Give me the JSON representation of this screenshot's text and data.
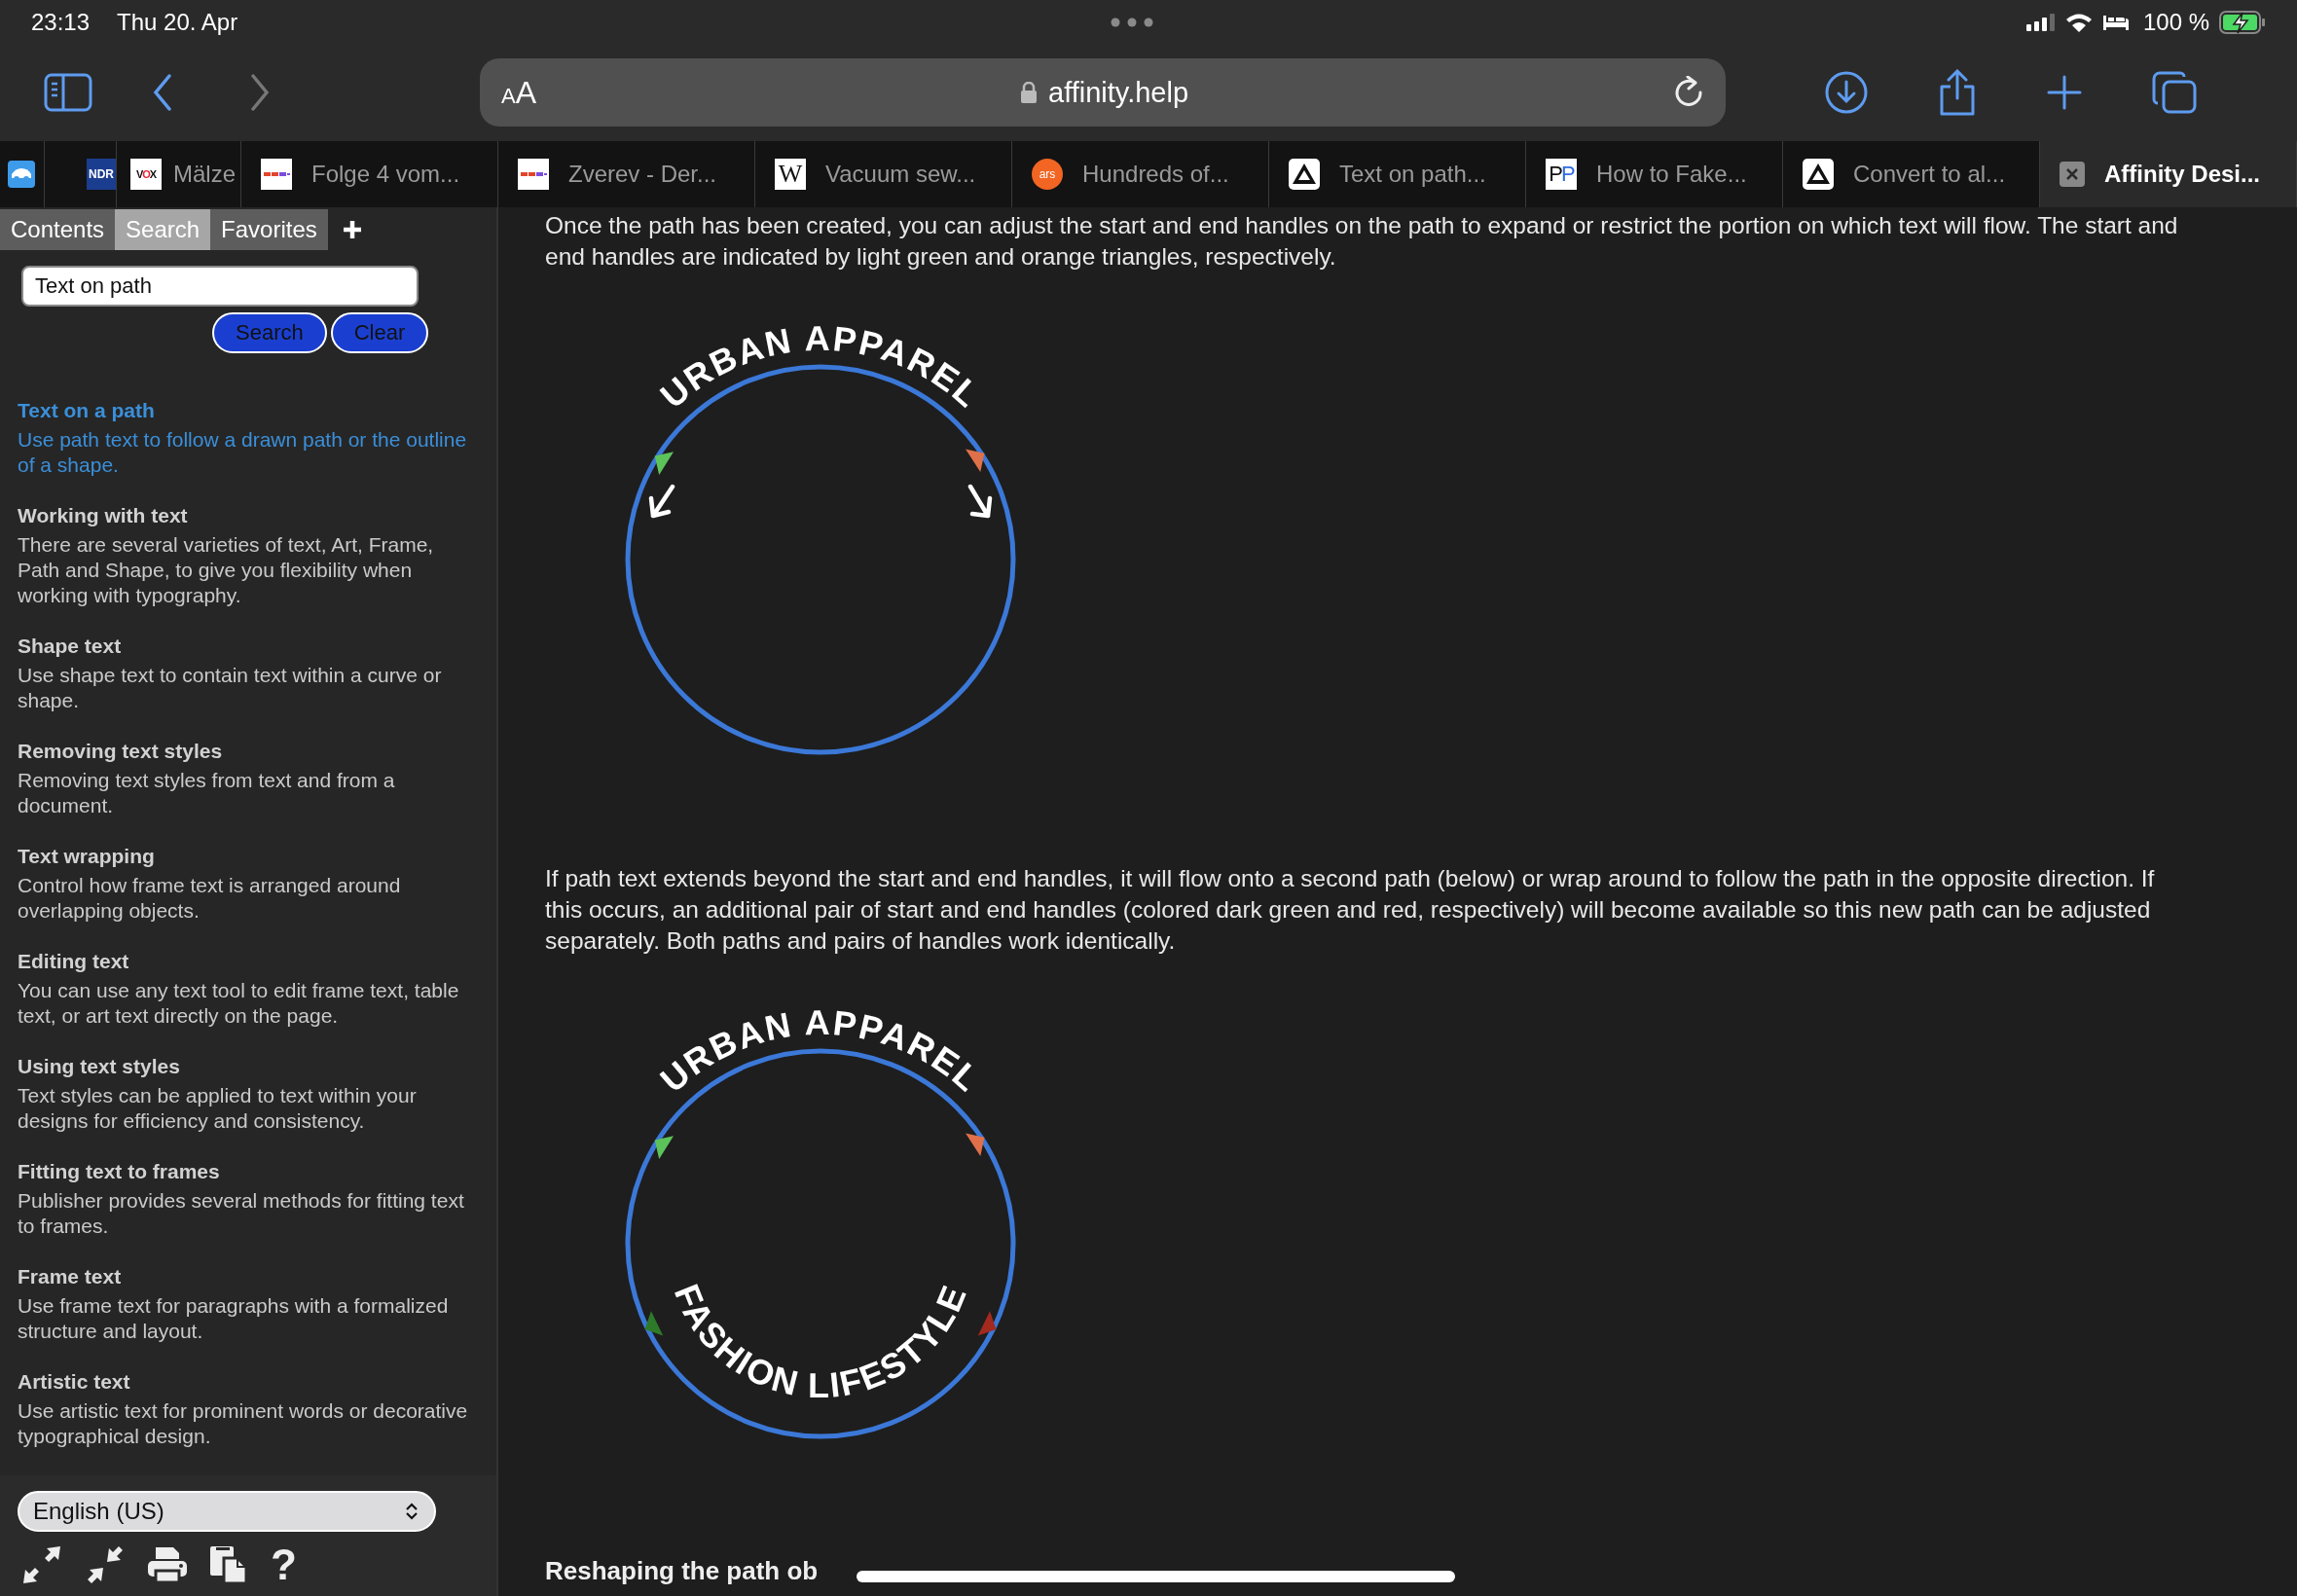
{
  "status_bar": {
    "time": "23:13",
    "date": "Thu 20. Apr",
    "battery": "100 %",
    "charging": true
  },
  "toolbar": {
    "text_size": "AA",
    "url": "affinity.help"
  },
  "tabs": [
    {
      "kind": "car",
      "selected": false
    },
    {
      "kind": "ndr",
      "icon_text": "NDR",
      "selected": false
    },
    {
      "kind": "vox",
      "icon_text": "VOX",
      "label": "Mälze",
      "selected": false
    },
    {
      "kind": "stripes",
      "label": "Folge 4 vom...",
      "selected": false
    },
    {
      "kind": "stripes",
      "label": "Zverev - Der...",
      "selected": false
    },
    {
      "kind": "wiki",
      "icon_text": "W",
      "label": "Vacuum sew...",
      "selected": false
    },
    {
      "kind": "ars",
      "icon_text": "ars",
      "label": "Hundreds of...",
      "selected": false
    },
    {
      "kind": "affinity",
      "label": "Text on path...",
      "selected": false
    },
    {
      "kind": "pp",
      "icon_text": "PP",
      "label": "How to Fake...",
      "selected": false
    },
    {
      "kind": "affinity",
      "label": "Convert to al...",
      "selected": false
    },
    {
      "kind": "close",
      "label": "Affinity Desi...",
      "selected": true
    }
  ],
  "sidebar": {
    "tabs": [
      {
        "label": "Contents",
        "selected": false
      },
      {
        "label": "Search",
        "selected": true
      },
      {
        "label": "Favorites",
        "selected": false
      }
    ],
    "search": {
      "value": "Text on path"
    },
    "buttons": [
      "Search",
      "Clear"
    ],
    "results": [
      {
        "title": "Text on a path",
        "description": "Use path text to follow a drawn path or the outline of a shape.",
        "selected": true
      },
      {
        "title": "Working with text",
        "description": "There are several varieties of text, Art, Frame, Path and Shape, to give you flexibility when working with typography.",
        "selected": false
      },
      {
        "title": "Shape text",
        "description": "Use shape text to contain text within a curve or shape.",
        "selected": false
      },
      {
        "title": "Removing text styles",
        "description": "Removing text styles from text and from a document.",
        "selected": false
      },
      {
        "title": "Text wrapping",
        "description": "Control how frame text is arranged around overlapping objects.",
        "selected": false
      },
      {
        "title": "Editing text",
        "description": "You can use any text tool to edit frame text, table text, or art text directly on the page.",
        "selected": false
      },
      {
        "title": "Using text styles",
        "description": "Text styles can be applied to text within your designs for efficiency and consistency.",
        "selected": false
      },
      {
        "title": "Fitting text to frames",
        "description": "Publisher provides several methods for fitting text to frames.",
        "selected": false
      },
      {
        "title": "Frame text",
        "description": "Use frame text for paragraphs with a formalized structure and layout.",
        "selected": false
      },
      {
        "title": "Artistic text",
        "description": "Use artistic text for prominent words or decorative typographical design.",
        "selected": false
      }
    ],
    "language": "English (US)",
    "help": "?"
  },
  "content": [
    {
      "kind": "paragraph",
      "text": "Once the path has been created, you can adjust the start and end handles on the path to expand or restrict the portion on which text will flow. The start and end handles are indicated by light green and orange triangles, respectively."
    },
    {
      "kind": "figure",
      "top_text": "URBAN APPAREL",
      "arrows": true,
      "second_handles": false
    },
    {
      "kind": "paragraph",
      "text": "If path text extends beyond the start and end handles, it will flow onto a second path (below) or wrap around to follow the path in the opposite direction. If this occurs, an additional pair of start and end handles (colored dark green and red, respectively) will become available so this new path can be adjusted separately. Both paths and pairs of handles work identically."
    },
    {
      "kind": "figure",
      "top_text": "URBAN APPAREL",
      "bottom_text": "FASHION LIFESTYLE",
      "arrows": false,
      "second_handles": true
    },
    {
      "kind": "heading",
      "text": "Reshaping the path ob"
    }
  ]
}
